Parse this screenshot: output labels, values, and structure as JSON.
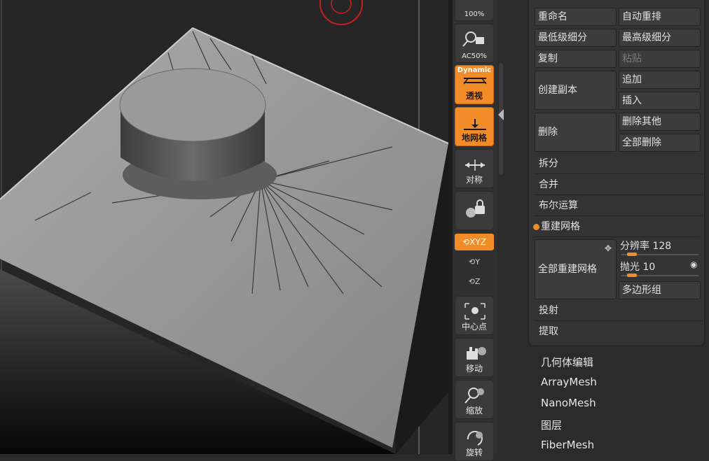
{
  "shelf": {
    "zoom100": "100%",
    "ac50": "AC50%",
    "dynamic_tag": "Dynamic",
    "perspective": "透视",
    "floor": "地网格",
    "symmetry": "对称",
    "lock_label": "",
    "xyz": "XYZ",
    "axis_y": "Y",
    "axis_z": "Z",
    "center": "中心点",
    "move": "移动",
    "scale": "缩放",
    "rotate": "旋转"
  },
  "geometry": {
    "rename": "重命名",
    "auto_reorder": "自动重排",
    "lowest_subdiv": "最低级细分",
    "highest_subdiv": "最高级细分",
    "copy": "复制",
    "paste": "粘贴",
    "duplicate": "创建副本",
    "append": "追加",
    "insert": "插入",
    "delete": "删除",
    "delete_other": "删除其他",
    "delete_all": "全部删除",
    "split": "拆分",
    "merge": "合并",
    "boolean": "布尔运算",
    "remesh": "重建网格",
    "remesh_all": "全部重建网格",
    "resolution_label": "分辨率",
    "resolution_value": "128",
    "polish_label": "抛光",
    "polish_value": "10",
    "polygroups": "多边形组",
    "project": "投射",
    "extract": "提取"
  },
  "subpalettes": [
    "几何体编辑",
    "ArrayMesh",
    "NanoMesh",
    "图层",
    "FiberMesh"
  ],
  "colors": {
    "accent": "#f28c28",
    "panel": "#333333",
    "button": "#3c3c3c"
  },
  "icons": [
    "zoom-icon",
    "actual-size-icon",
    "perspective-icon",
    "floor-grid-icon",
    "symmetry-icon",
    "lock-camera-icon",
    "rotate-y-icon",
    "rotate-z-icon",
    "center-point-icon",
    "move-hand-icon",
    "scale-icon",
    "rotate-icon"
  ]
}
